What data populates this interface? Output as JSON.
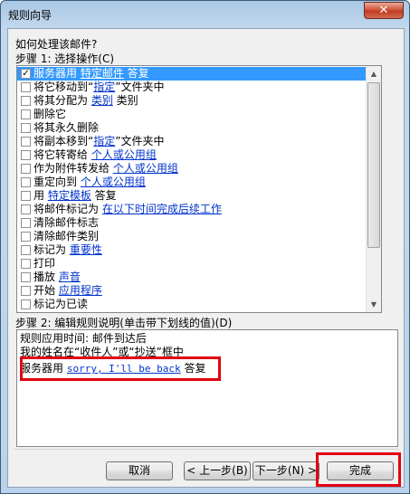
{
  "window": {
    "title": "规则向导",
    "close_glyph": "✕"
  },
  "question": "如何处理该邮件?",
  "step1": {
    "label": "步骤 1: 选择操作(C)",
    "items": [
      {
        "checked": true,
        "selected": true,
        "parts": [
          {
            "t": "服务器用 "
          },
          {
            "t": "特定邮件",
            "link": true
          },
          {
            "t": " 答复"
          }
        ]
      },
      {
        "checked": false,
        "selected": false,
        "parts": [
          {
            "t": "将它移动到“"
          },
          {
            "t": "指定",
            "link": true
          },
          {
            "t": "”文件夹中"
          }
        ]
      },
      {
        "checked": false,
        "selected": false,
        "parts": [
          {
            "t": "将其分配为 "
          },
          {
            "t": "类别",
            "link": true
          },
          {
            "t": " 类别"
          }
        ]
      },
      {
        "checked": false,
        "selected": false,
        "parts": [
          {
            "t": "删除它"
          }
        ]
      },
      {
        "checked": false,
        "selected": false,
        "parts": [
          {
            "t": "将其永久删除"
          }
        ]
      },
      {
        "checked": false,
        "selected": false,
        "parts": [
          {
            "t": "将副本移到“"
          },
          {
            "t": "指定",
            "link": true
          },
          {
            "t": "”文件夹中"
          }
        ]
      },
      {
        "checked": false,
        "selected": false,
        "parts": [
          {
            "t": "将它转寄给 "
          },
          {
            "t": "个人或公用组",
            "link": true
          }
        ]
      },
      {
        "checked": false,
        "selected": false,
        "parts": [
          {
            "t": "作为附件转发给 "
          },
          {
            "t": "个人或公用组",
            "link": true
          }
        ]
      },
      {
        "checked": false,
        "selected": false,
        "parts": [
          {
            "t": "重定向到 "
          },
          {
            "t": "个人或公用组",
            "link": true
          }
        ]
      },
      {
        "checked": false,
        "selected": false,
        "parts": [
          {
            "t": "用 "
          },
          {
            "t": "特定模板",
            "link": true
          },
          {
            "t": " 答复"
          }
        ]
      },
      {
        "checked": false,
        "selected": false,
        "parts": [
          {
            "t": "将邮件标记为 "
          },
          {
            "t": "在以下时间完成后续工作",
            "link": true
          }
        ]
      },
      {
        "checked": false,
        "selected": false,
        "parts": [
          {
            "t": "清除邮件标志"
          }
        ]
      },
      {
        "checked": false,
        "selected": false,
        "parts": [
          {
            "t": "清除邮件类别"
          }
        ]
      },
      {
        "checked": false,
        "selected": false,
        "parts": [
          {
            "t": "标记为 "
          },
          {
            "t": "重要性",
            "link": true
          }
        ]
      },
      {
        "checked": false,
        "selected": false,
        "parts": [
          {
            "t": "打印"
          }
        ]
      },
      {
        "checked": false,
        "selected": false,
        "parts": [
          {
            "t": "播放 "
          },
          {
            "t": "声音",
            "link": true
          }
        ]
      },
      {
        "checked": false,
        "selected": false,
        "parts": [
          {
            "t": "开始 "
          },
          {
            "t": "应用程序",
            "link": true
          }
        ]
      },
      {
        "checked": false,
        "selected": false,
        "parts": [
          {
            "t": "标记为已读"
          }
        ]
      }
    ]
  },
  "step2": {
    "label": "步骤 2: 编辑规则说明(单击带下划线的值)(D)",
    "line1": "规则应用时间: 邮件到达后",
    "line2": "我的姓名在“收件人”或“抄送”框中",
    "line3_prefix": "服务器用 ",
    "line3_link": "sorry, I'll be back",
    "line3_suffix": " 答复"
  },
  "buttons": {
    "cancel": "取消",
    "back": "< 上一步(B)",
    "next": "下一步(N) >",
    "finish": "完成"
  },
  "scrollbar": {
    "up_glyph": "▲",
    "down_glyph": "▼"
  },
  "colors": {
    "link": "#0033cc",
    "selection": "#3399ff",
    "highlight_frame": "#e3000f"
  }
}
